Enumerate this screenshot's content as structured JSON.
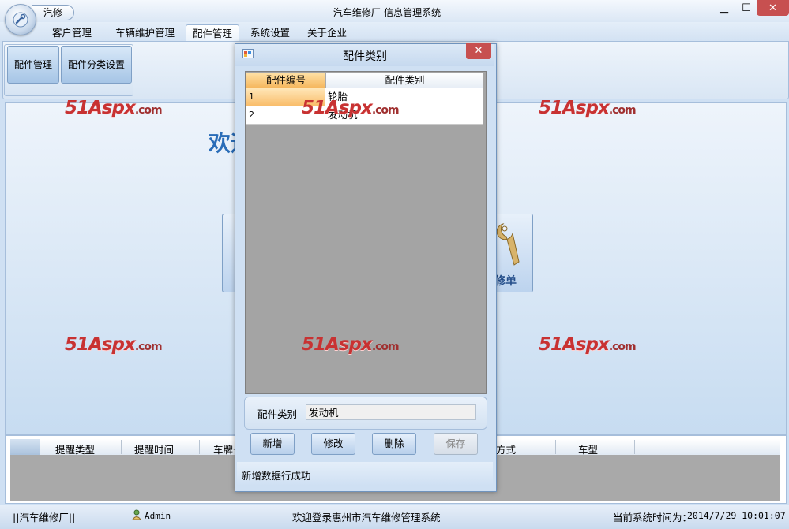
{
  "app": {
    "title": "汽车维修厂-信息管理系统",
    "quick_access_label": "汽修",
    "window_controls": {
      "minimize": "▁",
      "maximize": "☐",
      "close": "✕"
    }
  },
  "menu": {
    "tabs": [
      {
        "label": "客户管理"
      },
      {
        "label": "车辆维护管理"
      },
      {
        "label": "配件管理",
        "active": true
      },
      {
        "label": "系统设置"
      },
      {
        "label": "关于企业"
      }
    ]
  },
  "ribbon": {
    "buttons": [
      {
        "label": "配件管理"
      },
      {
        "label": "配件分类设置"
      }
    ]
  },
  "main": {
    "welcome_text": "欢迎",
    "tile_right_label": "修单",
    "watermark": {
      "num": "51",
      "brand": "Aspx",
      "domain": ".com"
    }
  },
  "reminder_grid": {
    "columns": [
      "提醒类型",
      "提醒时间",
      "车牌号",
      "方式",
      "车型"
    ]
  },
  "status": {
    "company": "||汽车维修厂||",
    "user": "Admin",
    "welcome": "欢迎登录惠州市汽车维修管理系统",
    "time_label": "当前系统时间为：",
    "time_value": "2014/7/29 10:01:07"
  },
  "dialog": {
    "title": "配件类别",
    "grid": {
      "columns": [
        "配件编号",
        "配件类别"
      ],
      "rows": [
        {
          "id": "1",
          "category": "轮胎"
        },
        {
          "id": "2",
          "category": "发动机"
        }
      ]
    },
    "form": {
      "label": "配件类别",
      "value": "发动机"
    },
    "buttons": {
      "add": "新增",
      "edit": "修改",
      "delete": "删除",
      "save": "保存"
    },
    "message": "新增数据行成功"
  },
  "colors": {
    "accent": "#2a6db8",
    "close_red": "#c75050",
    "selected_cell": "#f9bd6b",
    "grid_empty": "#a4a4a4"
  }
}
